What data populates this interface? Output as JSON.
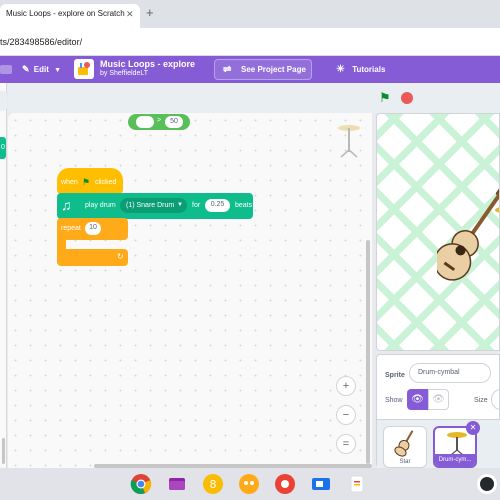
{
  "browser": {
    "tab_title": "Music Loops - explore on Scratch",
    "tab_close": "✕",
    "new_tab": "+",
    "url": "ts/283498586/editor/"
  },
  "menubar": {
    "edit_label": "Edit",
    "project_title": "Music Loops - explore",
    "project_author": "by SheffieldeLT",
    "see_project_label": "See Project Page",
    "tutorials_label": "Tutorials",
    "accent": "#855cd6"
  },
  "workspace": {
    "left_strip_value": "0",
    "operator_sign": ">",
    "operator_right": "50",
    "hat_label_1": "when",
    "hat_label_2": "clicked",
    "play_drum_label": "play drum",
    "drum_option": "(1) Snare Drum",
    "for_label": "for",
    "beats_value": "0.25",
    "beats_label": "beats",
    "repeat_label": "repeat",
    "repeat_count": "10",
    "zoom_in": "+",
    "zoom_out": "−",
    "zoom_reset": "="
  },
  "sprite_pane": {
    "sprite_label": "Sprite",
    "sprite_name": "Drum-cymbal",
    "show_label": "Show",
    "size_label": "Size",
    "sprites": [
      {
        "name": "Star"
      },
      {
        "name": "Drum-cym..."
      }
    ]
  },
  "colors": {
    "motion_music": "#0fbd8c",
    "events": "#ffbf00",
    "control": "#ffab19",
    "operators": "#59c059"
  }
}
